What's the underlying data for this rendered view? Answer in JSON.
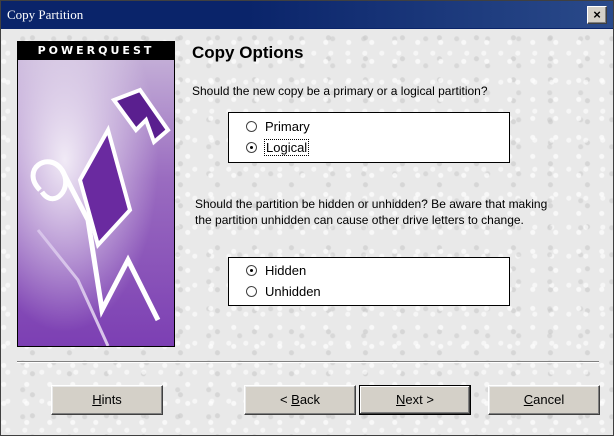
{
  "window": {
    "title": "Copy Partition",
    "close_label": "×"
  },
  "banner": {
    "logo_text": "POWERQUEST"
  },
  "main": {
    "heading": "Copy Options",
    "question1": "Should the new copy be a primary or a logical partition?",
    "partition_type": {
      "options": [
        {
          "label": "Primary",
          "checked": false
        },
        {
          "label": "Logical",
          "checked": true
        }
      ]
    },
    "question2": "Should the partition be hidden or unhidden?  Be aware that making the partition unhidden can cause other drive letters to change.",
    "visibility": {
      "options": [
        {
          "label": "Hidden",
          "checked": true
        },
        {
          "label": "Unhidden",
          "checked": false
        }
      ]
    }
  },
  "buttons": {
    "hints": {
      "accel": "H",
      "rest": "ints"
    },
    "back": {
      "prefix": "< ",
      "accel": "B",
      "rest": "ack"
    },
    "next": {
      "accel": "N",
      "rest": "ext >"
    },
    "cancel": {
      "accel": "C",
      "rest": "ancel"
    }
  },
  "colors": {
    "titlebar": "#0a246a",
    "banner_purple": "#7c3fb3"
  }
}
